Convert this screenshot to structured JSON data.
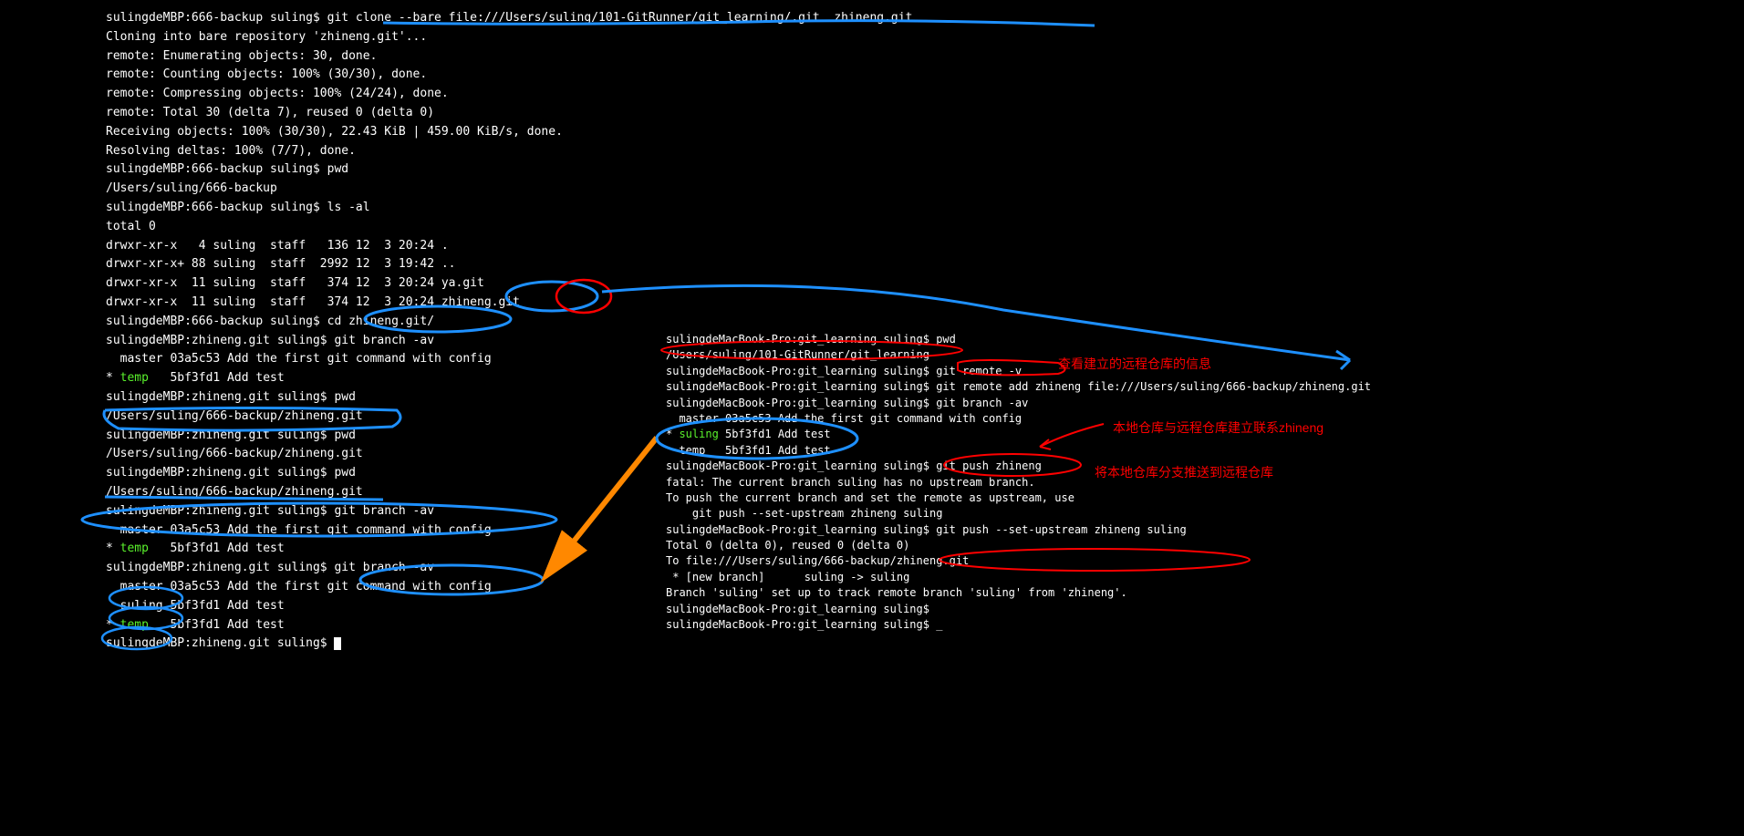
{
  "left_terminal": {
    "lines": [
      "sulingdeMBP:666-backup suling$ git clone --bare file:///Users/suling/101-GitRunner/git_learning/.git  zhineng.git",
      "Cloning into bare repository 'zhineng.git'...",
      "remote: Enumerating objects: 30, done.",
      "remote: Counting objects: 100% (30/30), done.",
      "remote: Compressing objects: 100% (24/24), done.",
      "remote: Total 30 (delta 7), reused 0 (delta 0)",
      "Receiving objects: 100% (30/30), 22.43 KiB | 459.00 KiB/s, done.",
      "Resolving deltas: 100% (7/7), done.",
      "sulingdeMBP:666-backup suling$ pwd",
      "/Users/suling/666-backup",
      "sulingdeMBP:666-backup suling$ ls -al",
      "total 0",
      "drwxr-xr-x   4 suling  staff   136 12  3 20:24 .",
      "drwxr-xr-x+ 88 suling  staff  2992 12  3 19:42 ..",
      "drwxr-xr-x  11 suling  staff   374 12  3 20:24 ya.git",
      "drwxr-xr-x  11 suling  staff   374 12  3 20:24 zhineng.git",
      "sulingdeMBP:666-backup suling$ cd zhineng.git/",
      "sulingdeMBP:zhineng.git suling$ git branch -av",
      "  master 03a5c53 Add the first git command with config",
      {
        "pre": "* ",
        "green": "temp",
        "post": "   5bf3fd1 Add test"
      },
      "sulingdeMBP:zhineng.git suling$ pwd",
      "/Users/suling/666-backup/zhineng.git",
      "sulingdeMBP:zhineng.git suling$ pwd",
      "/Users/suling/666-backup/zhineng.git",
      "sulingdeMBP:zhineng.git suling$ pwd",
      "/Users/suling/666-backup/zhineng.git",
      "sulingdeMBP:zhineng.git suling$ git branch -av",
      "  master 03a5c53 Add the first git command with config",
      {
        "pre": "* ",
        "green": "temp",
        "post": "   5bf3fd1 Add test"
      },
      "sulingdeMBP:zhineng.git suling$ git branch -av",
      "  master 03a5c53 Add the first git command with config",
      "  suling 5bf3fd1 Add test",
      {
        "pre": "* ",
        "green": "temp",
        "post": "   5bf3fd1 Add test"
      },
      "sulingdeMBP:zhineng.git suling$ "
    ]
  },
  "right_terminal": {
    "lines": [
      "sulingdeMacBook-Pro:git_learning suling$ pwd",
      "/Users/suling/101-GitRunner/git_learning",
      "sulingdeMacBook-Pro:git_learning suling$ git remote -v",
      "sulingdeMacBook-Pro:git_learning suling$ git remote add zhineng file:///Users/suling/666-backup/zhineng.git",
      "sulingdeMacBook-Pro:git_learning suling$ git branch -av",
      "  master 03a5c53 Add the first git command with config",
      {
        "pre": "* ",
        "green": "suling",
        "post": " 5bf3fd1 Add test"
      },
      "  temp   5bf3fd1 Add test",
      "sulingdeMacBook-Pro:git_learning suling$ git push zhineng",
      "fatal: The current branch suling has no upstream branch.",
      "To push the current branch and set the remote as upstream, use",
      "",
      "    git push --set-upstream zhineng suling",
      "",
      "sulingdeMacBook-Pro:git_learning suling$ git push --set-upstream zhineng suling",
      "Total 0 (delta 0), reused 0 (delta 0)",
      "To file:///Users/suling/666-backup/zhineng.git",
      " * [new branch]      suling -> suling",
      "Branch 'suling' set up to track remote branch 'suling' from 'zhineng'.",
      "sulingdeMacBook-Pro:git_learning suling$ ",
      "sulingdeMacBook-Pro:git_learning suling$ _"
    ]
  },
  "annotations": {
    "a1": "查看建立的远程仓库的信息",
    "a2": "本地仓库与远程仓库建立联系zhineng",
    "a3": "将本地仓库分支推送到远程仓库"
  }
}
